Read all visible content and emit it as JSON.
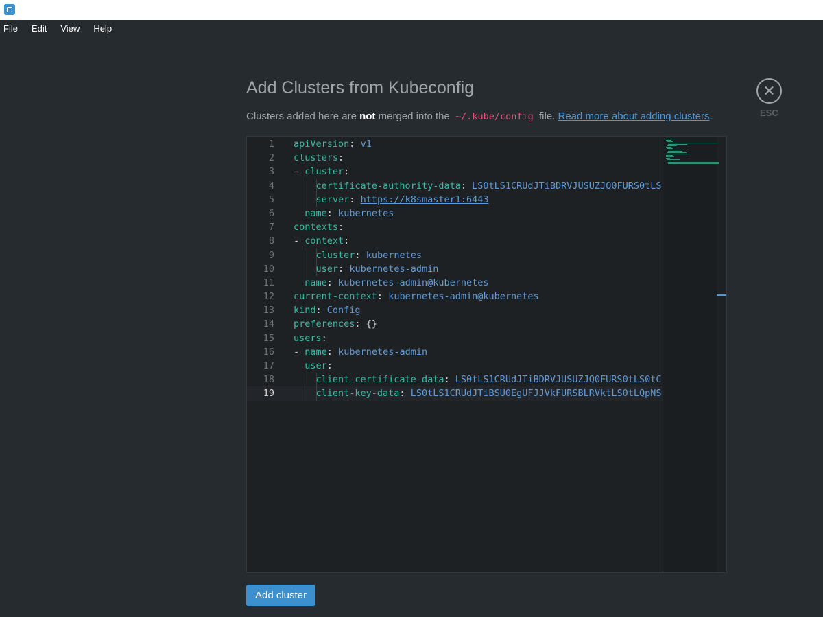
{
  "menu": [
    "File",
    "Edit",
    "View",
    "Help"
  ],
  "page": {
    "title": "Add Clusters from Kubeconfig",
    "subtitle_pre": "Clusters added here are ",
    "subtitle_bold": "not",
    "subtitle_mid": " merged into the ",
    "subtitle_code": "~/.kube/config",
    "subtitle_post": " file. ",
    "subtitle_link": "Read more about adding clusters",
    "subtitle_end": ".",
    "close_label": "ESC",
    "close_icon": "close-icon",
    "add_button": "Add cluster"
  },
  "editor": {
    "lines": [
      {
        "n": "1",
        "indent": "",
        "key": "apiVersion",
        "val": "v1"
      },
      {
        "n": "2",
        "indent": "",
        "key": "clusters",
        "val": ""
      },
      {
        "n": "3",
        "indent": "- ",
        "key": "cluster",
        "val": ""
      },
      {
        "n": "4",
        "indent": "    ",
        "key": "certificate-authority-data",
        "val": "LS0tLS1CRUdJTiBDRVJUSUZJQ0FURS0tLS"
      },
      {
        "n": "5",
        "indent": "    ",
        "key": "server",
        "val": "https://k8smaster1:6443",
        "link": true
      },
      {
        "n": "6",
        "indent": "  ",
        "key": "name",
        "val": "kubernetes"
      },
      {
        "n": "7",
        "indent": "",
        "key": "contexts",
        "val": ""
      },
      {
        "n": "8",
        "indent": "- ",
        "key": "context",
        "val": ""
      },
      {
        "n": "9",
        "indent": "    ",
        "key": "cluster",
        "val": "kubernetes"
      },
      {
        "n": "10",
        "indent": "    ",
        "key": "user",
        "val": "kubernetes-admin"
      },
      {
        "n": "11",
        "indent": "  ",
        "key": "name",
        "val": "kubernetes-admin@kubernetes"
      },
      {
        "n": "12",
        "indent": "",
        "key": "current-context",
        "val": "kubernetes-admin@kubernetes"
      },
      {
        "n": "13",
        "indent": "",
        "key": "kind",
        "val": "Config"
      },
      {
        "n": "14",
        "indent": "",
        "key": "preferences",
        "val": "{}",
        "plain": true
      },
      {
        "n": "15",
        "indent": "",
        "key": "users",
        "val": ""
      },
      {
        "n": "16",
        "indent": "- ",
        "key": "name",
        "val": "kubernetes-admin"
      },
      {
        "n": "17",
        "indent": "  ",
        "key": "user",
        "val": ""
      },
      {
        "n": "18",
        "indent": "    ",
        "key": "client-certificate-data",
        "val": "LS0tLS1CRUdJTiBDRVJUSUZJQ0FURS0tLS0tC"
      },
      {
        "n": "19",
        "indent": "    ",
        "key": "client-key-data",
        "val": "LS0tLS1CRUdJTiBSU0EgUFJJVkFURSBLRVktLS0tLQpNS",
        "active": true
      }
    ]
  },
  "colors": {
    "background": "#262b2f",
    "accent": "#3d90ce",
    "yaml_key": "#3ab9a5",
    "yaml_value": "#5f9ad8",
    "inline_code": "#e5527c"
  }
}
